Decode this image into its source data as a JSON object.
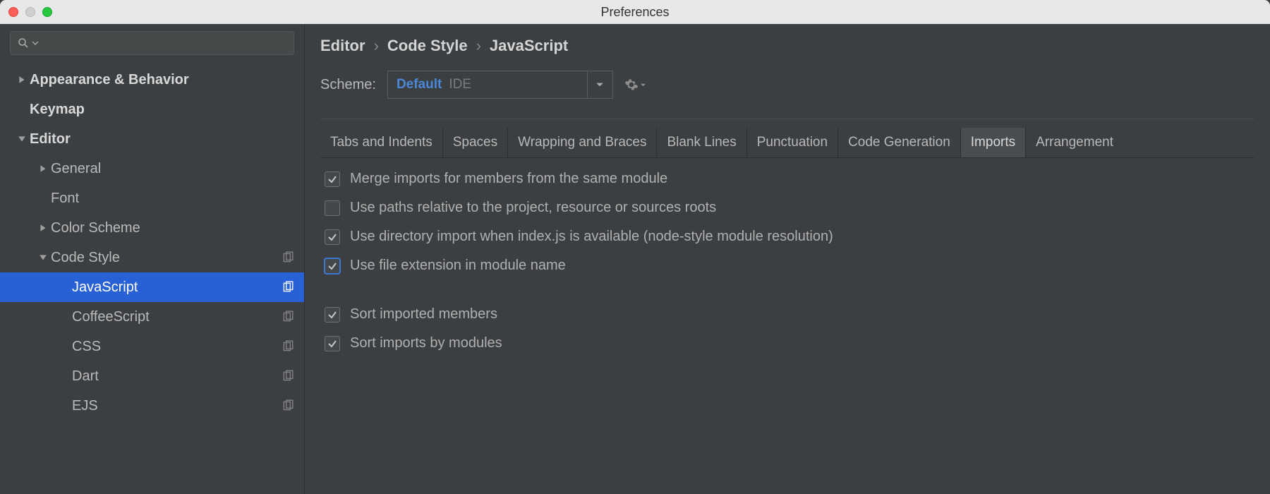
{
  "window": {
    "title": "Preferences"
  },
  "sidebar": {
    "search_placeholder": "",
    "items": [
      {
        "label": "Appearance & Behavior"
      },
      {
        "label": "Keymap"
      },
      {
        "label": "Editor"
      },
      {
        "label": "General"
      },
      {
        "label": "Font"
      },
      {
        "label": "Color Scheme"
      },
      {
        "label": "Code Style"
      },
      {
        "label": "JavaScript"
      },
      {
        "label": "CoffeeScript"
      },
      {
        "label": "CSS"
      },
      {
        "label": "Dart"
      },
      {
        "label": "EJS"
      }
    ]
  },
  "breadcrumb": {
    "a": "Editor",
    "b": "Code Style",
    "c": "JavaScript"
  },
  "scheme": {
    "label": "Scheme:",
    "name": "Default",
    "badge": "IDE"
  },
  "tabs": [
    {
      "label": "Tabs and Indents"
    },
    {
      "label": "Spaces"
    },
    {
      "label": "Wrapping and Braces"
    },
    {
      "label": "Blank Lines"
    },
    {
      "label": "Punctuation"
    },
    {
      "label": "Code Generation"
    },
    {
      "label": "Imports"
    },
    {
      "label": "Arrangement"
    }
  ],
  "options": [
    {
      "label": "Merge imports for members from the same module",
      "checked": true,
      "focused": false
    },
    {
      "label": "Use paths relative to the project, resource or sources roots",
      "checked": false,
      "focused": false
    },
    {
      "label": "Use directory import when index.js is available (node-style module resolution)",
      "checked": true,
      "focused": false
    },
    {
      "label": "Use file extension in module name",
      "checked": true,
      "focused": true
    },
    {
      "label": "Sort imported members",
      "checked": true,
      "focused": false
    },
    {
      "label": "Sort imports by modules",
      "checked": true,
      "focused": false
    }
  ]
}
